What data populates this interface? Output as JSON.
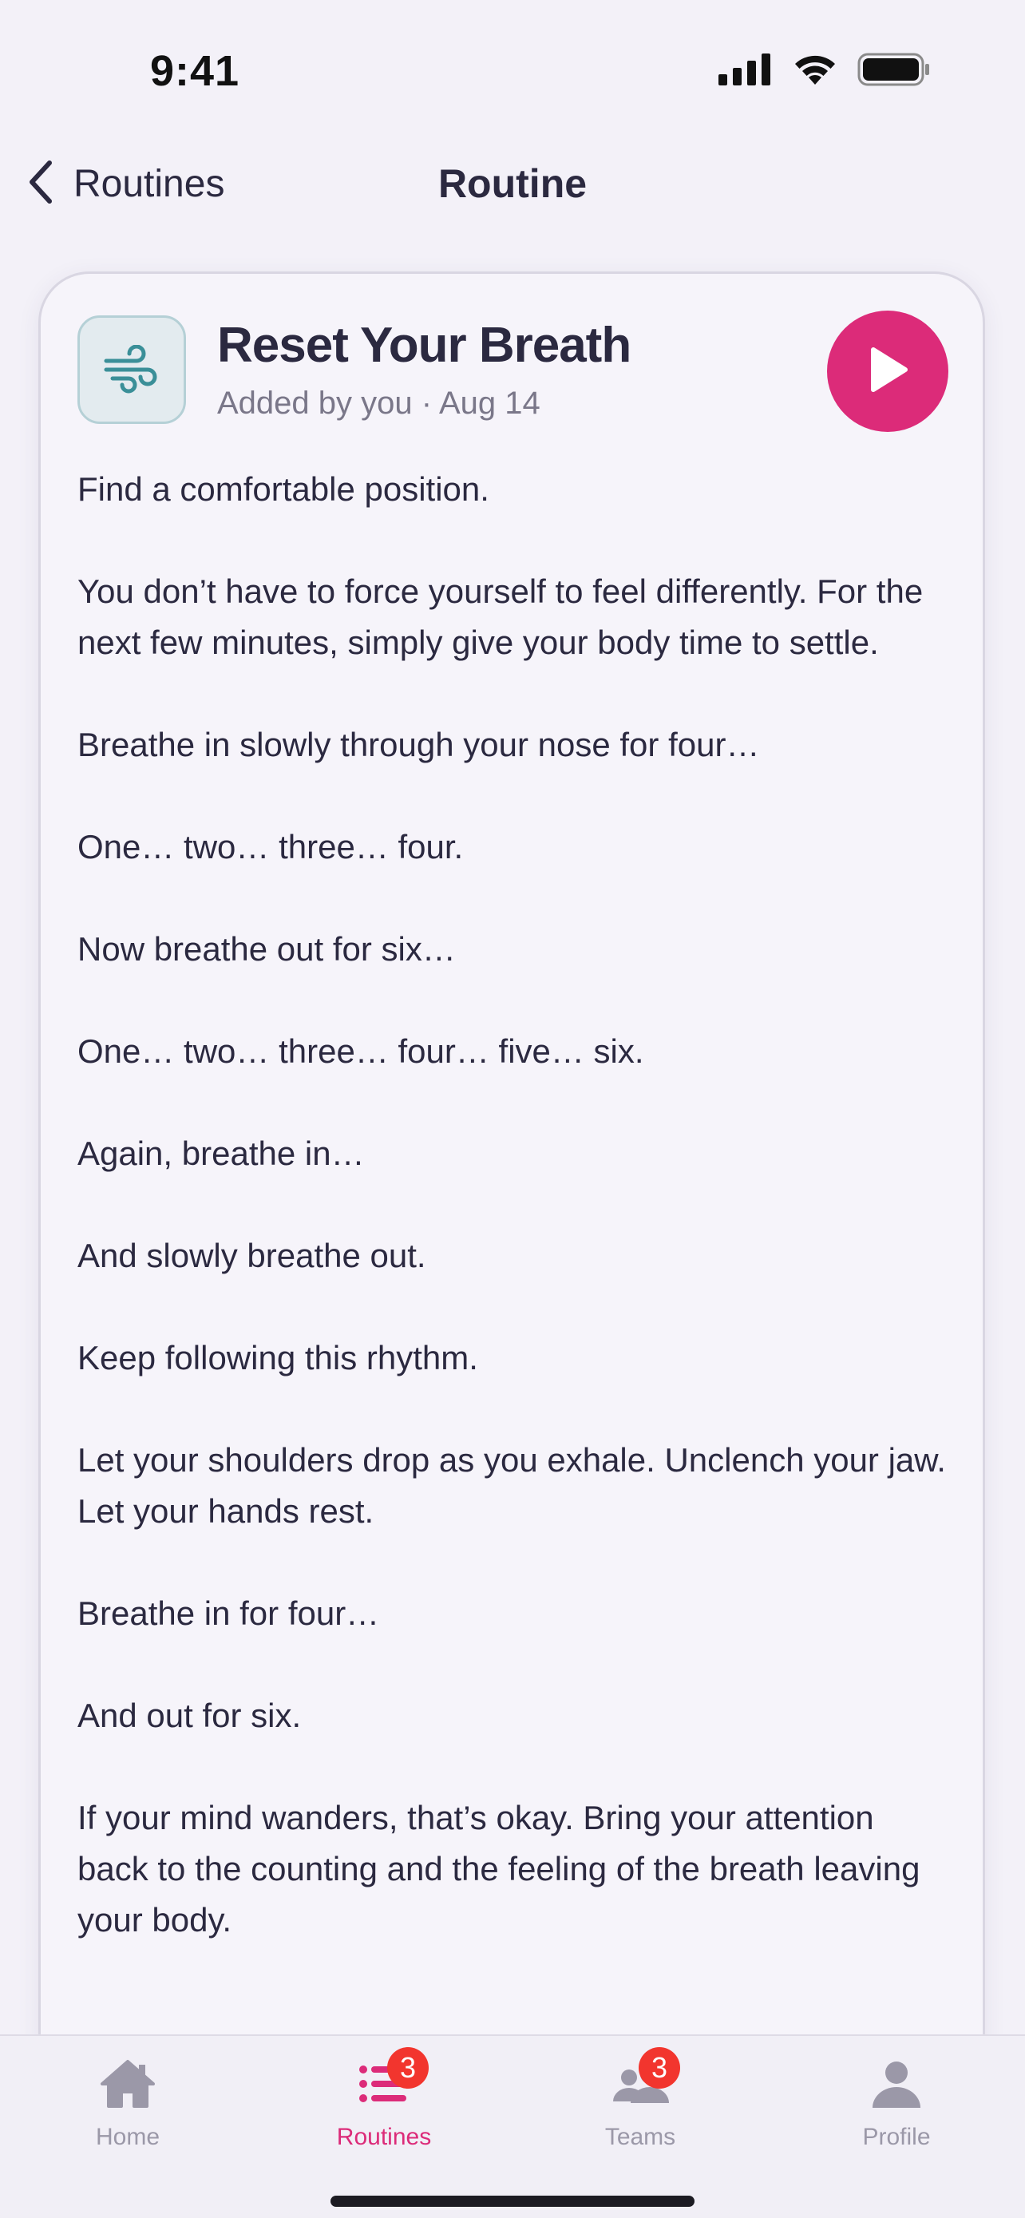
{
  "status_bar": {
    "time": "9:41",
    "icons": [
      "cellular-signal-icon",
      "wifi-icon",
      "battery-icon"
    ]
  },
  "nav": {
    "back_label": "Routines",
    "title": "Routine"
  },
  "routine": {
    "icon": "wind-icon",
    "title": "Reset Your Breath",
    "meta": "Added by you · Aug 14",
    "paragraphs": [
      "Find a comfortable position.",
      "You don’t have to force yourself to feel differently. For the next few minutes, simply give your body time to settle.",
      "Breathe in slowly through your nose for four…",
      "One… two… three… four.",
      "Now breathe out for six…",
      "One… two… three… four… five… six.",
      "Again, breathe in…",
      "And slowly breathe out.",
      "Keep following this rhythm.",
      "Let your shoulders drop as you exhale. Unclench your jaw. Let your hands rest.",
      "Breathe in for four…",
      "And out for six.",
      "If your mind wanders, that’s okay. Bring your attention back to the counting and the feeling of the breath leaving your body."
    ]
  },
  "tabs": [
    {
      "label": "Home",
      "icon": "home-icon",
      "active": false,
      "badge": null
    },
    {
      "label": "Routines",
      "icon": "list-icon",
      "active": true,
      "badge": "3"
    },
    {
      "label": "Teams",
      "icon": "people-icon",
      "active": false,
      "badge": "3"
    },
    {
      "label": "Profile",
      "icon": "person-icon",
      "active": false,
      "badge": null
    }
  ],
  "colors": {
    "accent": "#dc2b79",
    "badge": "#f2352e",
    "teal_icon": "#3a8f98",
    "inactive": "#9b98a8"
  }
}
